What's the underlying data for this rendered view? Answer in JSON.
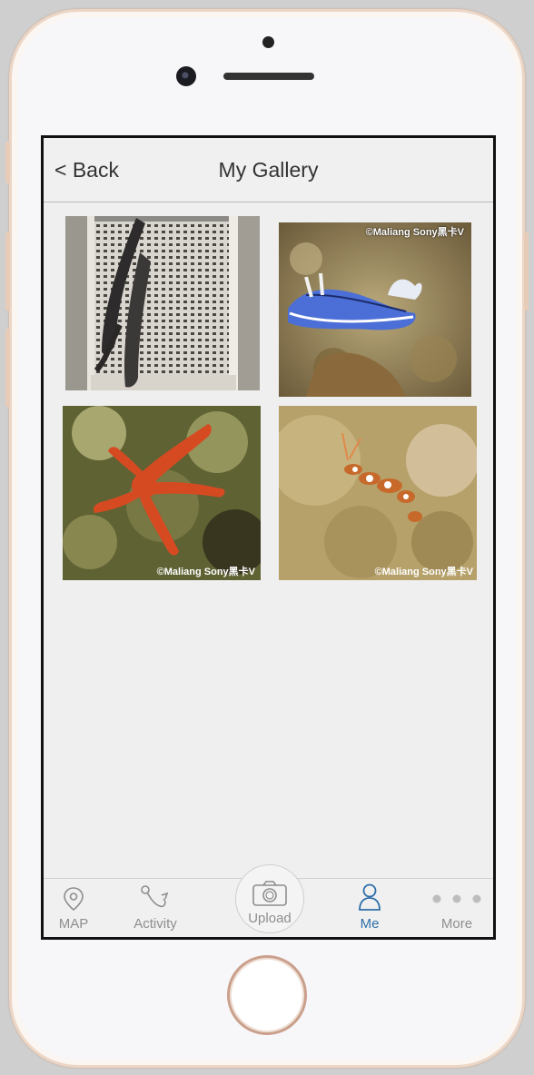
{
  "header": {
    "back_label": "< Back",
    "title": "My Gallery"
  },
  "gallery": {
    "photos": [
      {
        "subject": "eels in crate",
        "watermark": ""
      },
      {
        "subject": "blue nudibranch",
        "watermark": "©Maliang Sony黑卡V"
      },
      {
        "subject": "red starfish",
        "watermark": "©Maliang Sony黑卡V"
      },
      {
        "subject": "cleaner shrimp",
        "watermark": "©Maliang Sony黑卡V"
      }
    ]
  },
  "tabbar": {
    "items": [
      {
        "label": "MAP",
        "icon": "map-pin-icon"
      },
      {
        "label": "Activity",
        "icon": "activity-icon"
      },
      {
        "label": "Upload",
        "icon": "camera-icon"
      },
      {
        "label": "Me",
        "icon": "person-icon",
        "active": true
      },
      {
        "label": "More",
        "icon": "more-dots-icon"
      }
    ],
    "active_color": "#2f6fa8",
    "inactive_color": "#8e8e8e"
  }
}
